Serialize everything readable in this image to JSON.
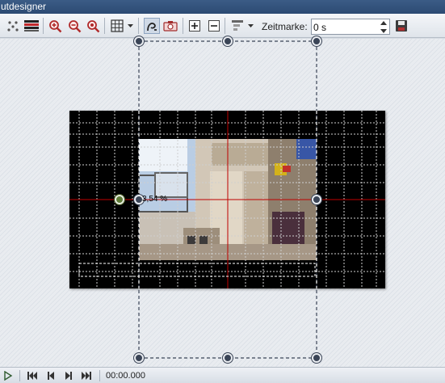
{
  "window": {
    "title": "utdesigner"
  },
  "toolbar": {
    "buttons": [
      {
        "icon": "node-points-icon"
      },
      {
        "icon": "color-bars-icon"
      },
      {
        "icon": "zoom-in-icon"
      },
      {
        "icon": "zoom-out-icon"
      },
      {
        "icon": "zoom-fit-icon"
      },
      {
        "icon": "grid-icon"
      },
      {
        "icon": "magnet-snap-icon"
      },
      {
        "icon": "camera-icon"
      },
      {
        "icon": "add-object-icon"
      },
      {
        "icon": "remove-object-icon"
      },
      {
        "icon": "align-icon"
      },
      {
        "icon": "save-icon"
      }
    ],
    "zeitmarke_label": "Zeitmarke:",
    "zeitmarke_value": "0 s"
  },
  "canvas": {
    "dimension_label": "3,54 %",
    "accent_color": "#c00000",
    "handle_color": "#3a4456"
  },
  "transport": {
    "timecode": "00:00.000"
  }
}
